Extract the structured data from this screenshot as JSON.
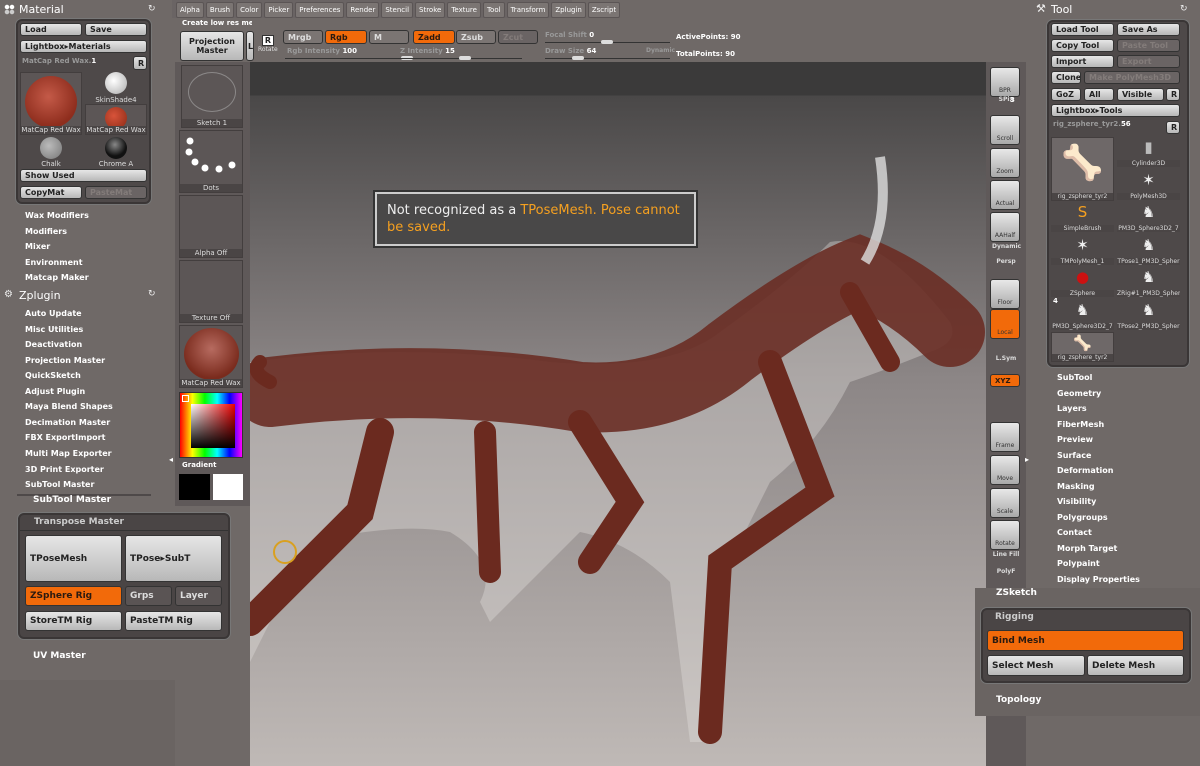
{
  "menubar": [
    "Alpha",
    "Brush",
    "Color",
    "Picker",
    "Preferences",
    "Render",
    "Stencil",
    "Stroke",
    "Texture",
    "Tool",
    "Transform",
    "Zplugin",
    "Zscript"
  ],
  "tooltip_line": "Create low res me",
  "toolbar": {
    "projection_master": "Projection Master",
    "lightbox": "Li",
    "rotate": "Rotate",
    "mrgb": "Mrgb",
    "rgb": "Rgb",
    "m": "M",
    "zadd": "Zadd",
    "zsub": "Zsub",
    "zcut": "Zcut",
    "focal_shift_label": "Focal Shift",
    "focal_shift": "0",
    "rgb_intensity_label": "Rgb Intensity",
    "rgb_intensity": "100",
    "z_intensity_label": "Z Intensity",
    "z_intensity": "15",
    "draw_size_label": "Draw Size",
    "draw_size": "64",
    "dynamic": "Dynamic",
    "active_points": "ActivePoints: 90",
    "total_points": "TotalPoints: 90"
  },
  "material": {
    "title": "Material",
    "load": "Load",
    "save": "Save",
    "lightbox": "Lightbox▸Materials",
    "current": "MatCap Red Wax.",
    "current_num": "1",
    "r": "R",
    "items": [
      "MatCap Red Wax",
      "SkinShade4",
      "MatCap Red Wax",
      "Chalk",
      "Chrome A"
    ],
    "show_used": "Show Used",
    "copymat": "CopyMat",
    "pastemat": "PasteMat"
  },
  "left_menu": [
    "Wax Modifiers",
    "Modifiers",
    "Mixer",
    "Environment",
    "Matcap Maker"
  ],
  "zplugin": {
    "title": "Zplugin",
    "items": [
      "Auto Update",
      "Misc Utilities",
      "Deactivation",
      "Projection Master",
      "QuickSketch",
      "Adjust Plugin",
      "Maya Blend Shapes",
      "Decimation Master",
      "FBX ExportImport",
      "Multi Map Exporter",
      "3D Print Exporter",
      "SubTool Master"
    ],
    "subtool_master": "SubTool Master",
    "uv_master": "UV Master"
  },
  "transpose": {
    "title": "Transpose Master",
    "tposemesh": "TPoseMesh",
    "tpose_subt": "TPose▸SubT",
    "zsphere_rig": "ZSphere Rig",
    "grps": "Grps",
    "layer": "Layer",
    "store": "StoreTM Rig",
    "paste": "PasteTM Rig"
  },
  "tray": {
    "sketch": "Sketch 1",
    "dots": "Dots",
    "alpha": "Alpha Off",
    "texture": "Texture Off",
    "material": "MatCap Red Wax",
    "gradient": "Gradient"
  },
  "message": {
    "pre": "Not recognized as a ",
    "highlight": "TPoseMesh",
    "post": ". Pose cannot be saved."
  },
  "shelf": {
    "bpr": "BPR",
    "spix_label": "SPix",
    "spix": "3",
    "scroll": "Scroll",
    "zoom": "Zoom",
    "actual": "Actual",
    "aahalf": "AAHalf",
    "dynamic": "Dynamic",
    "persp": "Persp",
    "floor": "Floor",
    "local": "Local",
    "lsym": "L.Sym",
    "xyz": "XYZ",
    "frame": "Frame",
    "move": "Move",
    "scale": "Scale",
    "rotate": "Rotate",
    "linefill": "Line Fill",
    "polyf": "PolyF"
  },
  "tool": {
    "title": "Tool",
    "load": "Load Tool",
    "save_as": "Save As",
    "copy": "Copy Tool",
    "paste": "Paste Tool",
    "import": "Import",
    "export": "Export",
    "clone": "Clone",
    "make_poly": "Make PolyMesh3D",
    "goz": "GoZ",
    "all": "All",
    "visible": "Visible",
    "r": "R",
    "lightbox": "Lightbox▸Tools",
    "current": "rig_zsphere_tyr2.",
    "current_num": "56",
    "count": "4",
    "items": [
      "rig_zsphere_tyr2",
      "Cylinder3D",
      "PolyMesh3D",
      "SimpleBrush",
      "PM3D_Sphere3D2_7",
      "TMPolyMesh_1",
      "TPose1_PM3D_Spher",
      "ZSphere",
      "ZRig#1_PM3D_Spher",
      "PM3D_Sphere3D2_7",
      "TPose2_PM3D_Spher",
      "rig_zsphere_tyr2"
    ]
  },
  "right_menu": [
    "SubTool",
    "Geometry",
    "Layers",
    "FiberMesh",
    "Preview",
    "Surface",
    "Deformation",
    "Masking",
    "Visibility",
    "Polygroups",
    "Contact",
    "Morph Target",
    "Polypaint",
    "Display Properties"
  ],
  "zsketch": "ZSketch",
  "rigging": {
    "title": "Rigging",
    "bind": "Bind Mesh",
    "select": "Select Mesh",
    "delete": "Delete Mesh"
  },
  "topology": "Topology",
  "colors": {
    "accent": "#f26a0a",
    "message_highlight": "#f5a020"
  }
}
